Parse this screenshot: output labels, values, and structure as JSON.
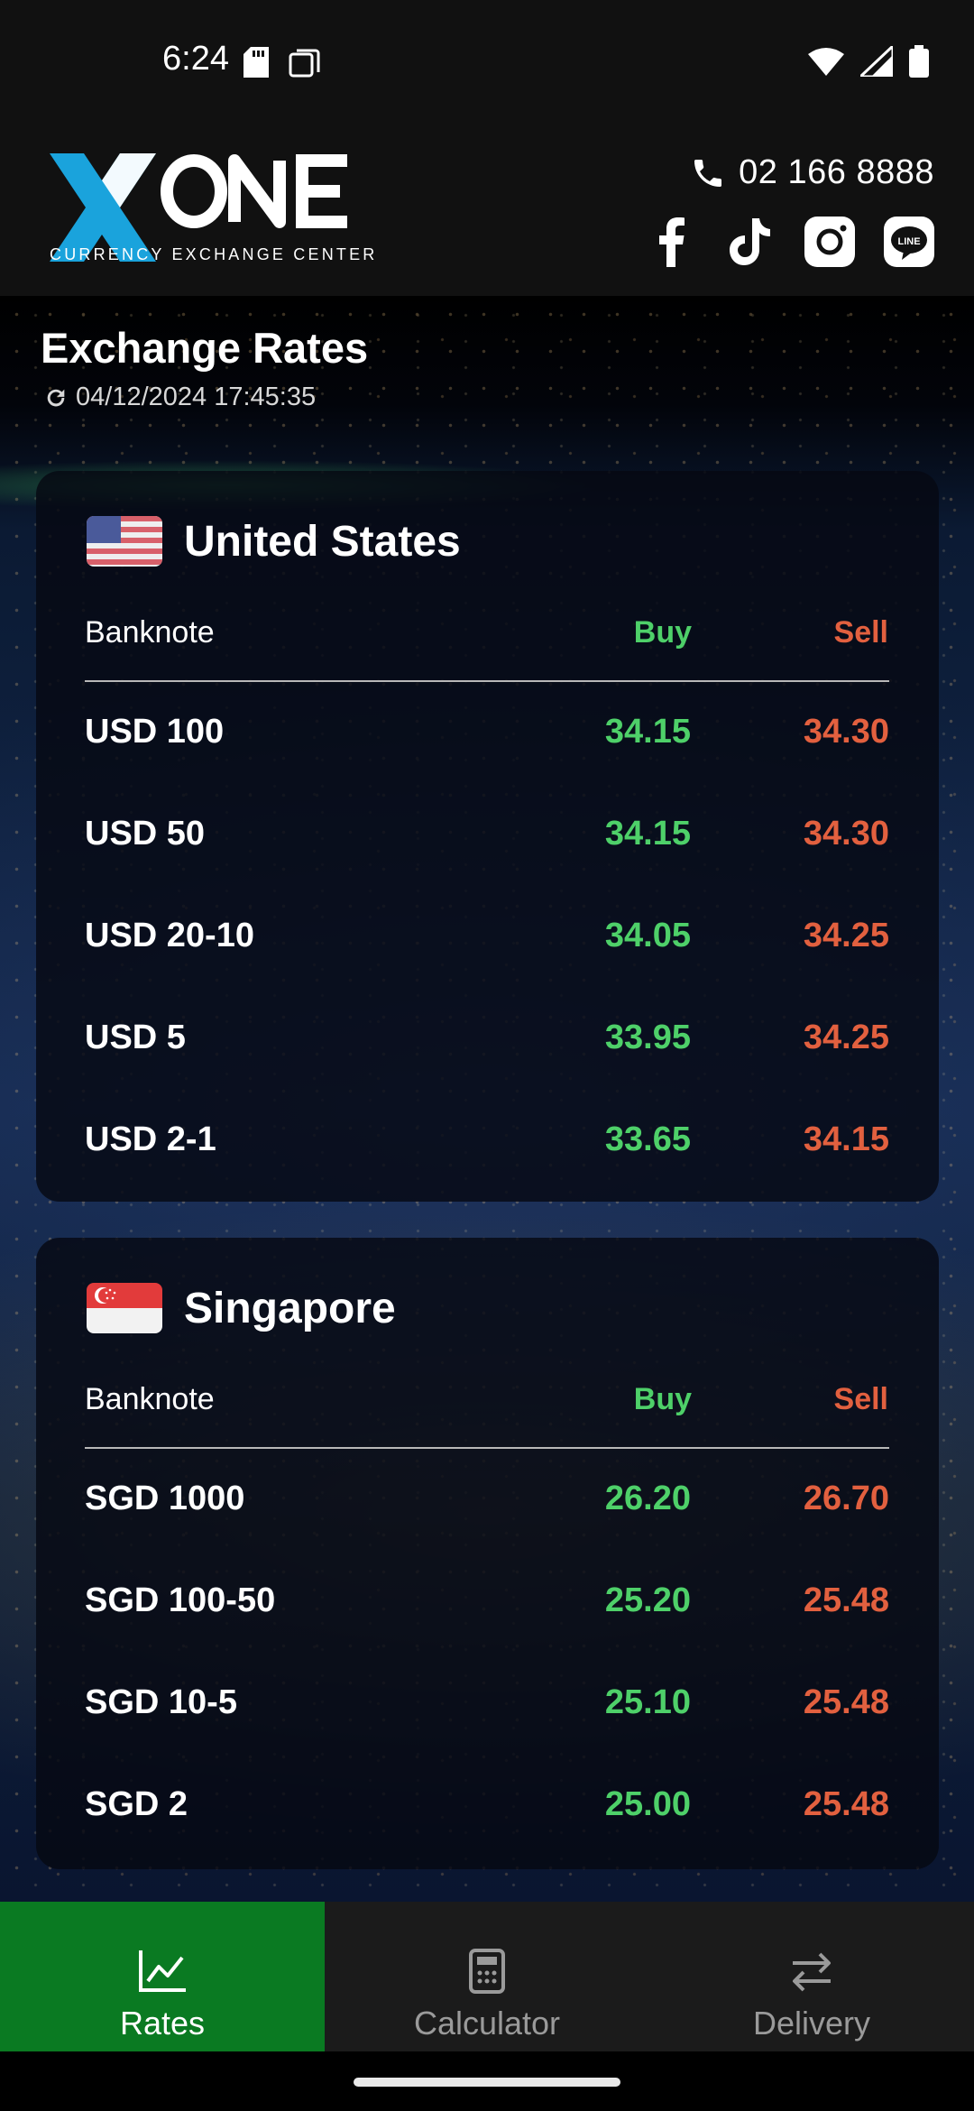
{
  "status_bar": {
    "time": "6:24"
  },
  "header": {
    "logo_text": "XONE",
    "logo_subtitle": "CURRENCY EXCHANGE CENTER",
    "phone": "02 166 8888",
    "social": [
      "facebook-icon",
      "tiktok-icon",
      "instagram-icon",
      "line-icon"
    ]
  },
  "page": {
    "title": "Exchange Rates",
    "timestamp": "04/12/2024 17:45:35"
  },
  "colors": {
    "buy": "#4ed069",
    "sell": "#e2603f",
    "nav_active": "#0a7a22"
  },
  "cards": [
    {
      "country": "United States",
      "flag": "us-flag",
      "headers": {
        "banknote": "Banknote",
        "buy": "Buy",
        "sell": "Sell"
      },
      "rows": [
        {
          "label": "USD 100",
          "buy": "34.15",
          "sell": "34.30"
        },
        {
          "label": "USD 50",
          "buy": "34.15",
          "sell": "34.30"
        },
        {
          "label": "USD 20-10",
          "buy": "34.05",
          "sell": "34.25"
        },
        {
          "label": "USD 5",
          "buy": "33.95",
          "sell": "34.25"
        },
        {
          "label": "USD 2-1",
          "buy": "33.65",
          "sell": "34.15"
        }
      ]
    },
    {
      "country": "Singapore",
      "flag": "sg-flag",
      "headers": {
        "banknote": "Banknote",
        "buy": "Buy",
        "sell": "Sell"
      },
      "rows": [
        {
          "label": "SGD 1000",
          "buy": "26.20",
          "sell": "26.70"
        },
        {
          "label": "SGD 100-50",
          "buy": "25.20",
          "sell": "25.48"
        },
        {
          "label": "SGD 10-5",
          "buy": "25.10",
          "sell": "25.48"
        },
        {
          "label": "SGD 2",
          "buy": "25.00",
          "sell": "25.48"
        }
      ]
    }
  ],
  "bottom_nav": [
    {
      "label": "Rates",
      "icon": "chart-line-icon",
      "active": true
    },
    {
      "label": "Calculator",
      "icon": "calculator-icon",
      "active": false
    },
    {
      "label": "Delivery",
      "icon": "swap-arrows-icon",
      "active": false
    }
  ]
}
